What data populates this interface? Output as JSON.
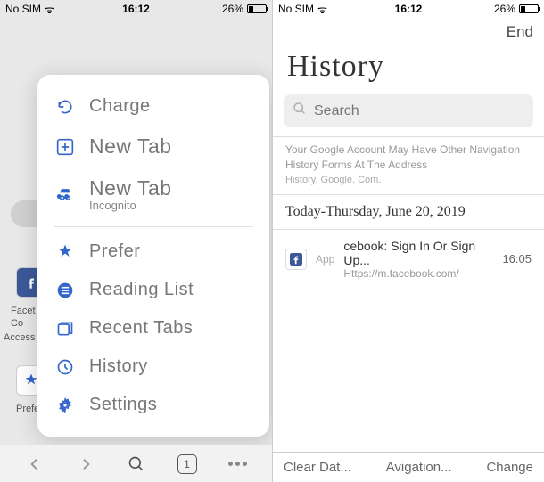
{
  "status": {
    "carrier": "No SIM",
    "time": "16:12",
    "battery_pct": "26%"
  },
  "left": {
    "bg": {
      "label1_line1": "Facet",
      "label1_line2": "Co",
      "label2": "Access",
      "label3": "Prefe"
    },
    "menu": {
      "charge": "Charge",
      "new_tab": "New Tab",
      "new_tab2": "New Tab",
      "incognito": "Incognito",
      "prefer": "Prefer",
      "reading_list": "Reading List",
      "recent_tabs": "Recent Tabs",
      "history": "History",
      "settings": "Settings"
    },
    "toolbar": {
      "tab_count": "1"
    }
  },
  "right": {
    "end": "End",
    "title": "History",
    "search_placeholder": "Search",
    "info1": "Your Google Account May Have Other Navigation History Forms At The Address",
    "info2": "History. Google. Com.",
    "date": "Today-Thursday, June 20, 2019",
    "entries": [
      {
        "app": "App",
        "title": "cebook: Sign In Or Sign Up...",
        "url": "Https://m.facebook.com/",
        "time": "16:05"
      }
    ],
    "footer": {
      "clear": "Clear Dat...",
      "nav": "Avigation...",
      "change": "Change"
    }
  }
}
